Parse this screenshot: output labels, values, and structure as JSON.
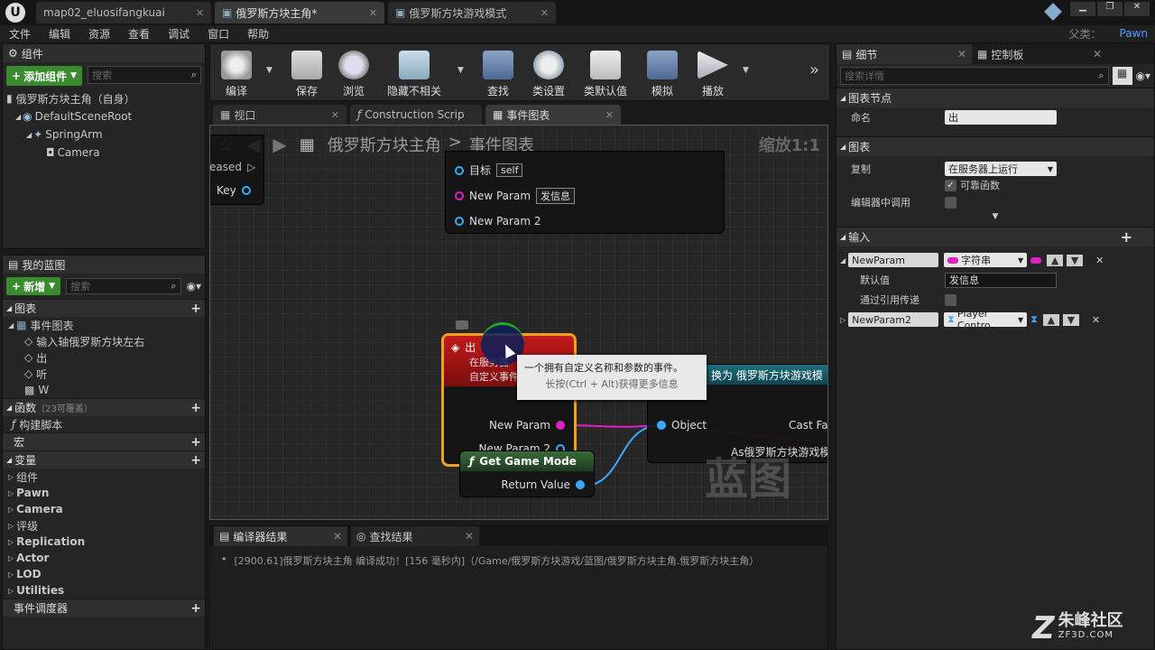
{
  "window": {
    "tabs": [
      {
        "label": "map02_eluosifangkuai"
      },
      {
        "label": "俄罗斯方块主角*"
      },
      {
        "label": "俄罗斯方块游戏模式"
      }
    ],
    "parent_label": "父类：",
    "parent_value": "Pawn"
  },
  "menu": [
    "文件",
    "编辑",
    "资源",
    "查看",
    "调试",
    "窗口",
    "帮助"
  ],
  "components": {
    "title": "组件",
    "add_button": "添加组件",
    "search_placeholder": "搜索",
    "self_item": "俄罗斯方块主角（自身）",
    "tree": [
      "DefaultSceneRoot",
      "SpringArm",
      "Camera"
    ]
  },
  "blueprint": {
    "title": "我的蓝图",
    "new_button": "新增",
    "search_placeholder": "搜索",
    "graph_section": "图表",
    "event_graph": "事件图表",
    "events": [
      "输入轴俄罗斯方块左右",
      "出",
      "听",
      "W"
    ],
    "functions_section": "函数",
    "functions_note": "（23可覆盖）",
    "construction": "构建脚本",
    "macros_section": "宏",
    "variables_section": "变量",
    "variable_groups": [
      "组件",
      "Pawn",
      "Camera",
      "评级",
      "Replication",
      "Actor",
      "LOD",
      "Utilities"
    ],
    "dispatcher_section": "事件调度器"
  },
  "toolbar": {
    "buttons": [
      "编译",
      "保存",
      "浏览",
      "隐藏不相关",
      "查找",
      "类设置",
      "类默认值",
      "模拟",
      "播放"
    ]
  },
  "graph_tabs": [
    "视口",
    "Construction Scrip",
    "事件图表"
  ],
  "graph": {
    "breadcrumb_root": "俄罗斯方块主角",
    "breadcrumb_sep": ">",
    "breadcrumb_leaf": "事件图表",
    "zoom": "缩放1:1",
    "watermark": "蓝图",
    "left_node": {
      "label_top": "eased",
      "key_label": "Key"
    },
    "call_node": {
      "target_label": "目标",
      "target_value": "self",
      "param1_label": "New Param",
      "param1_value": "发信息",
      "param2_label": "New Param 2"
    },
    "event_node": {
      "title": "出",
      "sub1": "在服务器",
      "sub2": "自定义事件",
      "param1": "New Param",
      "param2": "New Param 2"
    },
    "get_game_mode": {
      "title": "Get Game Mode",
      "output": "Return Value"
    },
    "cast_node": {
      "title": "换为 俄罗斯方块游戏模",
      "object_pin": "Object",
      "cast_failed": "Cast Fa",
      "as_pin": "As俄罗斯方块游戏模"
    },
    "tooltip": {
      "line1": "一个拥有自定义名称和参数的事件。",
      "line2": "长按(Ctrl + Alt)获得更多信息"
    }
  },
  "details": {
    "tabs": [
      "细节",
      "控制板"
    ],
    "search_placeholder": "搜索详情",
    "graph_node_section": "图表节点",
    "name_label": "命名",
    "name_value": "出",
    "graph_section": "图表",
    "replicate_label": "复制",
    "replicate_value": "在服务器上运行",
    "reliable_label": "可靠函数",
    "editor_call_label": "编辑器中调用",
    "input_section": "输入",
    "param1_name": "NewParam",
    "param1_type": "字符串",
    "default_label": "默认值",
    "default_value": "发信息",
    "by_ref_label": "通过引用传递",
    "param2_name": "NewParam2",
    "param2_type": "Player Contro"
  },
  "bottom": {
    "tabs": [
      "编译器结果",
      "查找结果"
    ],
    "log": "[2900.61]俄罗斯方块主角 编译成功！[156 毫秒内]（/Game/俄罗斯方块游戏/蓝图/俄罗斯方块主角.俄罗斯方块主角）"
  },
  "watermark": {
    "brand": "朱峰社区",
    "url": "ZF3D.COM"
  }
}
